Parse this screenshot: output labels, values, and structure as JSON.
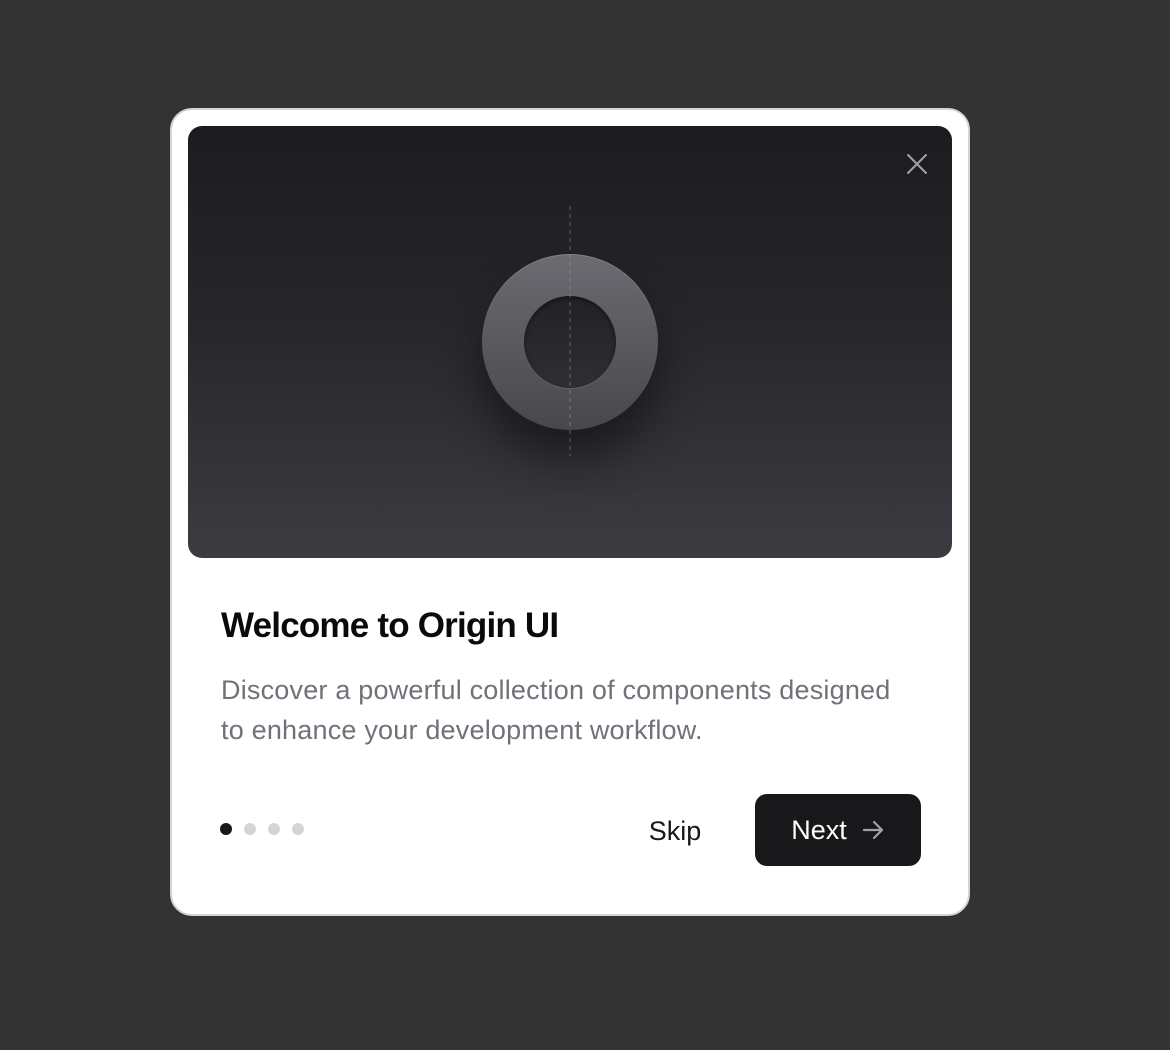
{
  "dialog": {
    "title": "Welcome to Origin UI",
    "description": "Discover a powerful collection of components designed to enhance your development workflow.",
    "close_icon": "close-icon",
    "hero_icon": "ring-logo-icon",
    "steps": {
      "total": 4,
      "current": 1
    },
    "skip_label": "Skip",
    "next_label": "Next",
    "next_icon": "arrow-right-icon"
  },
  "colors": {
    "backdrop": "#333333",
    "dialog_bg": "#ffffff",
    "primary_button": "#18181b",
    "muted_text": "#71717a",
    "inactive_dot": "#d4d4d8"
  }
}
